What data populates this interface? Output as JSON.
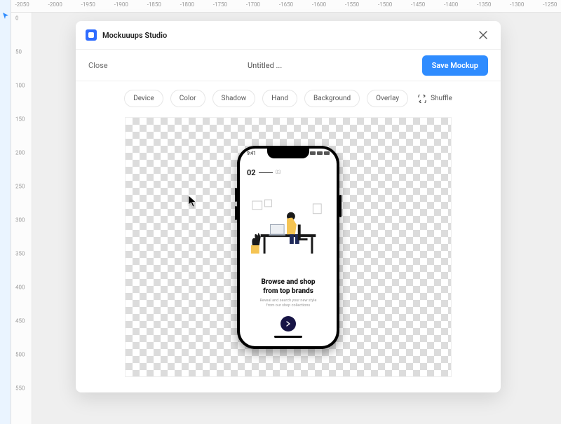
{
  "editor": {
    "ruler_h": [
      "-2050",
      "-2000",
      "-1950",
      "-1900",
      "-1850",
      "-1800",
      "-1750",
      "-1700",
      "-1650",
      "-1600",
      "-1550",
      "-1500",
      "-1450",
      "-1400",
      "-1350",
      "-1300",
      "-1250"
    ],
    "ruler_v": [
      "0",
      "50",
      "100",
      "150",
      "200",
      "250",
      "300",
      "350",
      "400",
      "450",
      "500",
      "550"
    ]
  },
  "modal": {
    "app_name": "Mockuuups Studio",
    "close_link": "Close",
    "doc_title": "Untitled ...",
    "save_label": "Save Mockup",
    "filters": {
      "device": "Device",
      "color": "Color",
      "shadow": "Shadow",
      "hand": "Hand",
      "background": "Background",
      "overlay": "Overlay",
      "shuffle": "Shuffle"
    }
  },
  "mockup": {
    "status_time": "9:41",
    "pager_current": "02",
    "pager_total": "03",
    "headline_line1": "Browse and shop",
    "headline_line2": "from top brands",
    "subline_line1": "Reveal and search your new style",
    "subline_line2": "from our shop collections"
  }
}
